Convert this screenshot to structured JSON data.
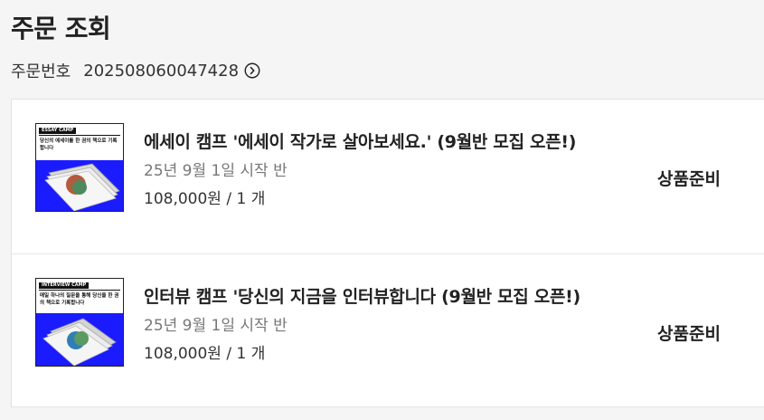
{
  "page": {
    "title": "주문 조회"
  },
  "order": {
    "label": "주문번호",
    "number": "202508060047428",
    "link_icon": "chevron-right-circle-icon"
  },
  "items": [
    {
      "thumb_tag": "ESSAY CAMP",
      "thumb_text": "당신의 에세이를 한 권의 책으로 기록합니다",
      "name": "에세이 캠프 '에세이 작가로 살아보세요.' (9월반 모집 오픈!)",
      "session": "25년 9월 1일 시작 반",
      "price": "108,000원 / 1 개",
      "status": "상품준비"
    },
    {
      "thumb_tag": "INTERVIEW CAMP",
      "thumb_text": "매일 하나의 질문을 통해 당신을 한 권의 책으로 기록합니다",
      "name": "인터뷰 캠프 '당신의 지금을 인터뷰합니다 (9월반 모집 오픈!)",
      "session": "25년 9월 1일 시작 반",
      "price": "108,000원 / 1 개",
      "status": "상품준비"
    }
  ],
  "colors": {
    "thumb_blue": "#1b1bff",
    "background": "#f5f5f5"
  }
}
